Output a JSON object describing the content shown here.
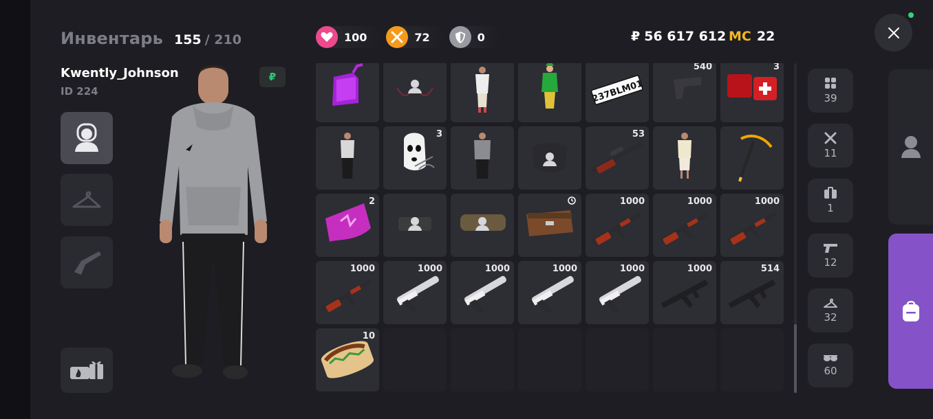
{
  "header": {
    "title": "Инвентарь",
    "count": "155",
    "max": "/ 210"
  },
  "player": {
    "name": "Kwently_Johnson",
    "id": "ID 224",
    "currency_badge": "₽"
  },
  "stats": [
    {
      "name": "health",
      "value": "100",
      "color": "#ec4a8c",
      "icon": "heart-icon"
    },
    {
      "name": "hunger",
      "value": "72",
      "color": "#f59a1a",
      "icon": "fork-knife-icon"
    },
    {
      "name": "armor",
      "value": "0",
      "color": "#9a9aa2",
      "icon": "shield-icon"
    }
  ],
  "money": {
    "symbol": "₽",
    "value": "56 617 612"
  },
  "mc": {
    "label": "MC",
    "value": "22"
  },
  "left_categories": [
    {
      "name": "character",
      "icon": "person-icon",
      "active": true
    },
    {
      "name": "clothes",
      "icon": "hanger-icon",
      "active": false
    },
    {
      "name": "weapons",
      "icon": "pistol-icon",
      "active": false
    }
  ],
  "gift_button": {
    "icon": "gift-icon"
  },
  "inventory": [
    {
      "item": "jerrycan",
      "qty": ""
    },
    {
      "item": "empty-placeholder-glasses",
      "qty": ""
    },
    {
      "item": "outfit-white",
      "qty": ""
    },
    {
      "item": "outfit-elf",
      "qty": ""
    },
    {
      "item": "license-plate",
      "qty": "",
      "text": "237BLM01"
    },
    {
      "item": "pistol",
      "qty": "540"
    },
    {
      "item": "medkit",
      "qty": "3"
    },
    {
      "item": "outfit-tshirt",
      "qty": ""
    },
    {
      "item": "ski-mask",
      "qty": "3"
    },
    {
      "item": "outfit-grey",
      "qty": ""
    },
    {
      "item": "empty-placeholder-bag",
      "qty": ""
    },
    {
      "item": "sniper-rifle",
      "qty": "53"
    },
    {
      "item": "outfit-light",
      "qty": ""
    },
    {
      "item": "golden-pickaxe",
      "qty": ""
    },
    {
      "item": "pink-flag",
      "qty": "2"
    },
    {
      "item": "placeholder-belt",
      "qty": ""
    },
    {
      "item": "placeholder-belt-wide",
      "qty": ""
    },
    {
      "item": "loot-crate",
      "qty": "",
      "timer": true
    },
    {
      "item": "ak-rifle",
      "qty": "1000"
    },
    {
      "item": "ak-rifle",
      "qty": "1000"
    },
    {
      "item": "ak-rifle",
      "qty": "1000"
    },
    {
      "item": "ak-rifle",
      "qty": "1000"
    },
    {
      "item": "silenced-pistol",
      "qty": "1000"
    },
    {
      "item": "silenced-pistol",
      "qty": "1000"
    },
    {
      "item": "silenced-pistol",
      "qty": "1000"
    },
    {
      "item": "silenced-pistol",
      "qty": "1000"
    },
    {
      "item": "smg",
      "qty": "1000"
    },
    {
      "item": "smg",
      "qty": "514"
    },
    {
      "item": "shawarma",
      "qty": "10"
    },
    {
      "item": "empty",
      "qty": ""
    },
    {
      "item": "empty",
      "qty": ""
    },
    {
      "item": "empty",
      "qty": ""
    },
    {
      "item": "empty",
      "qty": ""
    },
    {
      "item": "empty",
      "qty": ""
    },
    {
      "item": "empty",
      "qty": ""
    }
  ],
  "filters": [
    {
      "name": "all",
      "icon": "grid-icon",
      "count": "39"
    },
    {
      "name": "food",
      "icon": "fork-knife-icon",
      "count": "11"
    },
    {
      "name": "bags",
      "icon": "case-icon",
      "count": "1"
    },
    {
      "name": "weapons",
      "icon": "pistol-icon",
      "count": "12"
    },
    {
      "name": "clothes",
      "icon": "hanger-icon",
      "count": "32"
    },
    {
      "name": "accessories",
      "icon": "glasses-icon",
      "count": "60"
    }
  ],
  "side_tabs": [
    {
      "name": "profile",
      "icon": "person-icon",
      "color": "#26262d"
    },
    {
      "name": "backpack",
      "icon": "backpack-icon",
      "color": "#8552c8"
    }
  ]
}
